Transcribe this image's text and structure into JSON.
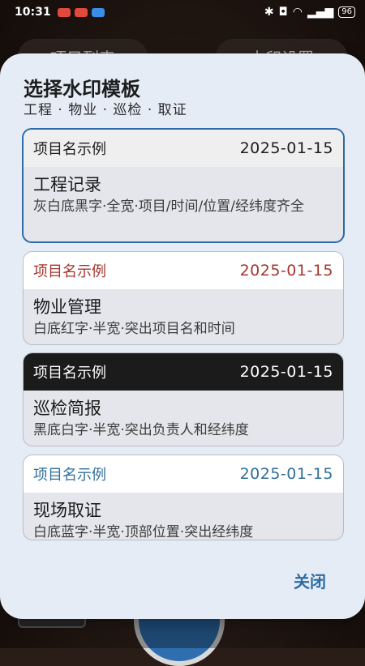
{
  "status_bar": {
    "time": "10:31",
    "battery": "96",
    "colors": {
      "notif_red": "#e04a3c",
      "notif_blue": "#3a8ee8"
    }
  },
  "background": {
    "left_button": "项目列表",
    "right_button": "水印设置"
  },
  "dialog": {
    "title": "选择水印模板",
    "subtitle": "工程 · 物业 · 巡检 · 取证",
    "close_label": "关闭",
    "accent_color": "#2c6aa8",
    "templates": [
      {
        "project_name": "项目名示例",
        "date": "2025-01-15",
        "name": "工程记录",
        "description": "灰白底黑字·全宽·项目/时间/位置/经纬度齐全",
        "selected": true
      },
      {
        "project_name": "项目名示例",
        "date": "2025-01-15",
        "name": "物业管理",
        "description": "白底红字·半宽·突出项目名和时间",
        "selected": false
      },
      {
        "project_name": "项目名示例",
        "date": "2025-01-15",
        "name": "巡检简报",
        "description": "黑底白字·半宽·突出负责人和经纬度",
        "selected": false
      },
      {
        "project_name": "项目名示例",
        "date": "2025-01-15",
        "name": "现场取证",
        "description": "白底蓝字·半宽·顶部位置·突出经纬度",
        "selected": false
      }
    ]
  }
}
